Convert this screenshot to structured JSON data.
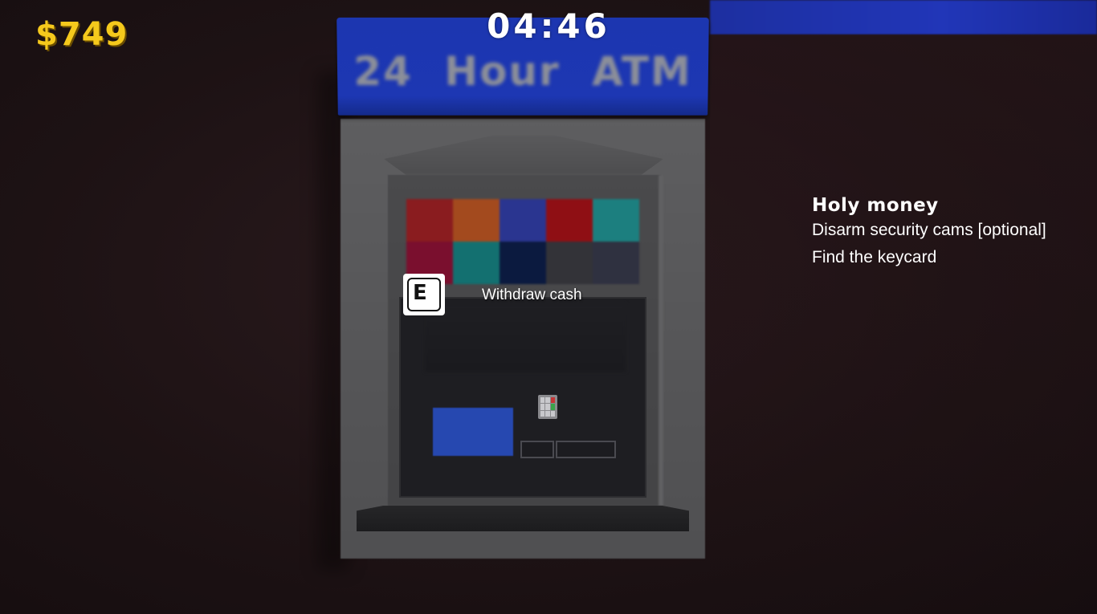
{
  "hud": {
    "money": "$749",
    "timer": "04:46"
  },
  "atm": {
    "sign_text": "24 Hour ATM",
    "tile_colors": [
      "#8a1c1f",
      "#a34a1e",
      "#2a3590",
      "#8f0f14",
      "#1c7f7f",
      "#7a0f2e",
      "#137070",
      "#0b1a3f",
      "#333338",
      "#2f3140"
    ]
  },
  "interaction": {
    "key": "E",
    "action_label": "Withdraw cash"
  },
  "objectives": {
    "title": "Holy money",
    "items": [
      "Disarm security cams [optional]",
      "Find the keycard"
    ]
  }
}
